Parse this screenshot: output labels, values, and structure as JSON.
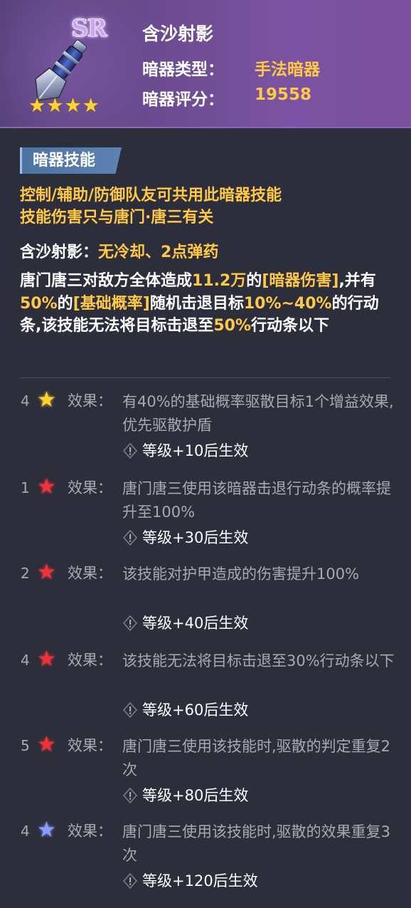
{
  "header": {
    "rarity": "SR",
    "stars": [
      "★",
      "★",
      "★",
      "★"
    ],
    "name": "含沙射影",
    "type_label": "暗器类型：",
    "type_value": "手法暗器",
    "score_label": "暗器评分：",
    "score_value": "19558"
  },
  "colors": {
    "accent": "#ffc847",
    "header_bg": "#6a4a8e",
    "body_bg": "#2c2e3b",
    "tag_bg": "#5d82b3"
  },
  "skill": {
    "tag": "暗器技能",
    "notice_1": "控制/辅助/防御队友可共用此暗器技能",
    "notice_2": "技能伤害只与唐门·唐三有关",
    "sub_name": "含沙射影：",
    "sub_info": "无冷却、2点弹药",
    "desc": [
      {
        "t": "唐门唐三对敌方全体造成",
        "y": false
      },
      {
        "t": "11.2万",
        "y": true
      },
      {
        "t": "的",
        "y": false
      },
      {
        "t": "[暗器伤害]",
        "y": true
      },
      {
        "t": ",并有",
        "y": false
      },
      {
        "t": "50%",
        "y": true
      },
      {
        "t": "的",
        "y": false
      },
      {
        "t": "[基础概率]",
        "y": true
      },
      {
        "t": "随机击退目标",
        "y": false
      },
      {
        "t": "10%~40%",
        "y": true
      },
      {
        "t": "的行动条,该技能无法将目标击退至",
        "y": false
      },
      {
        "t": "50%",
        "y": true
      },
      {
        "t": "行动条以下",
        "y": false
      }
    ]
  },
  "effects": [
    {
      "count": "4",
      "star_color": "#ffd233",
      "star_icon": "gold-star-icon",
      "label": "效果：",
      "text": "有40%的基础概率驱散目标1个增益效果,优先驱散护盾",
      "requirement": "等级+10后生效"
    },
    {
      "count": "1",
      "star_color": "#f0333a",
      "star_icon": "red-star-icon",
      "label": "效果：",
      "text": "唐门唐三使用该暗器击退行动条的概率提升至100%",
      "requirement": "等级+30后生效"
    },
    {
      "count": "2",
      "star_color": "#f0333a",
      "star_icon": "red-star-icon",
      "label": "效果：",
      "text": "该技能对护甲造成的伤害提升100%",
      "requirement": "等级+40后生效"
    },
    {
      "count": "4",
      "star_color": "#f0333a",
      "star_icon": "red-star-icon",
      "label": "效果：",
      "text": "该技能无法将目标击退至30%行动条以下",
      "requirement": "等级+60后生效"
    },
    {
      "count": "5",
      "star_color": "#f0333a",
      "star_icon": "red-star-icon",
      "label": "效果：",
      "text": "唐门唐三使用该技能时,驱散的判定重复2次",
      "requirement": "等级+80后生效"
    },
    {
      "count": "4",
      "star_color": "#8b9cff",
      "star_icon": "blue-star-icon",
      "label": "效果：",
      "text": "唐门唐三使用该技能时,驱散的效果重复3次",
      "requirement": "等级+120后生效"
    }
  ]
}
